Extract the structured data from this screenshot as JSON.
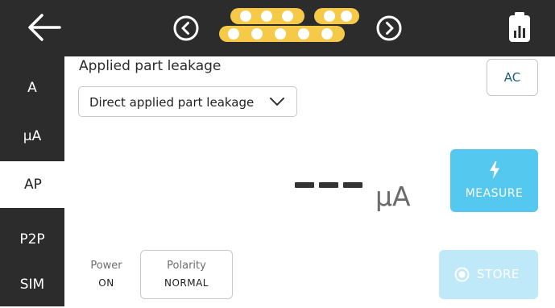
{
  "topbar": {
    "back_icon": "arrow-left-icon",
    "prev_icon": "chevron-left-circle-icon",
    "next_icon": "chevron-right-circle-icon",
    "report_icon": "clipboard-chart-icon",
    "progress_dots": {
      "row1_count": 5,
      "row2_count": 5,
      "color": "#f7c948"
    }
  },
  "sidebar": {
    "items": [
      {
        "label": "A",
        "active": false
      },
      {
        "label": "µA",
        "active": false
      },
      {
        "label": "AP",
        "active": true
      },
      {
        "label": "P2P",
        "active": false
      },
      {
        "label": "SIM",
        "active": false
      }
    ]
  },
  "main": {
    "title": "Applied part leakage",
    "test_select": {
      "value": "Direct applied part leakage",
      "icon": "chevron-down-icon"
    },
    "ac_button": "AC",
    "reading": {
      "value": "---",
      "unit": "µA"
    },
    "measure_button": {
      "label": "MEASURE",
      "icon": "lightning-icon"
    },
    "power": {
      "label": "Power",
      "value": "ON"
    },
    "polarity": {
      "label": "Polarity",
      "value": "NORMAL"
    },
    "store_button": {
      "label": "STORE",
      "icon": "record-icon",
      "enabled": false
    }
  },
  "colors": {
    "dark_bar": "#2c2c2c",
    "accent_blue": "#55c8ef",
    "accent_blue_disabled": "#bfe9f8",
    "dots_yellow": "#f7c948"
  }
}
